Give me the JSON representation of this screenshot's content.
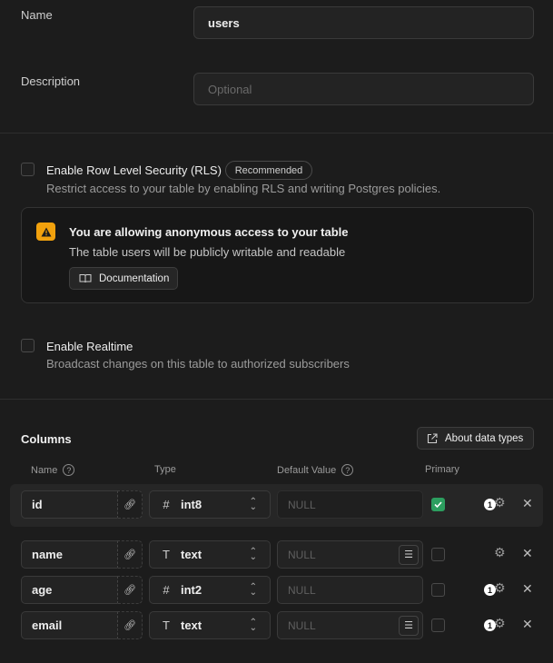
{
  "form": {
    "name_label": "Name",
    "name_value": "users",
    "description_label": "Description",
    "description_placeholder": "Optional"
  },
  "rls": {
    "title": "Enable Row Level Security (RLS)",
    "badge": "Recommended",
    "description": "Restrict access to your table by enabling RLS and writing Postgres policies."
  },
  "alert": {
    "title": "You are allowing anonymous access to your table",
    "message": "The table users will be publicly writable and readable",
    "button": "Documentation"
  },
  "realtime": {
    "title": "Enable Realtime",
    "description": "Broadcast changes on this table to authorized subscribers"
  },
  "columns": {
    "title": "Columns",
    "about_button": "About data types",
    "headers": {
      "name": "Name",
      "type": "Type",
      "default": "Default Value",
      "primary": "Primary"
    },
    "rows": [
      {
        "name": "id",
        "type": "int8",
        "type_icon": "hash-icon",
        "default": "NULL",
        "primary": true,
        "badge": "1"
      },
      {
        "name": "name",
        "type": "text",
        "type_icon": "text-type-icon",
        "default": "NULL",
        "primary": false,
        "badge": ""
      },
      {
        "name": "age",
        "type": "int2",
        "type_icon": "hash-icon",
        "default": "NULL",
        "primary": false,
        "badge": "1"
      },
      {
        "name": "email",
        "type": "text",
        "type_icon": "text-type-icon",
        "default": "NULL",
        "primary": false,
        "badge": "1"
      }
    ]
  },
  "colors": {
    "accent": "#2c9e5f",
    "warning": "#f1a10d",
    "background": "#1c1c1c"
  }
}
